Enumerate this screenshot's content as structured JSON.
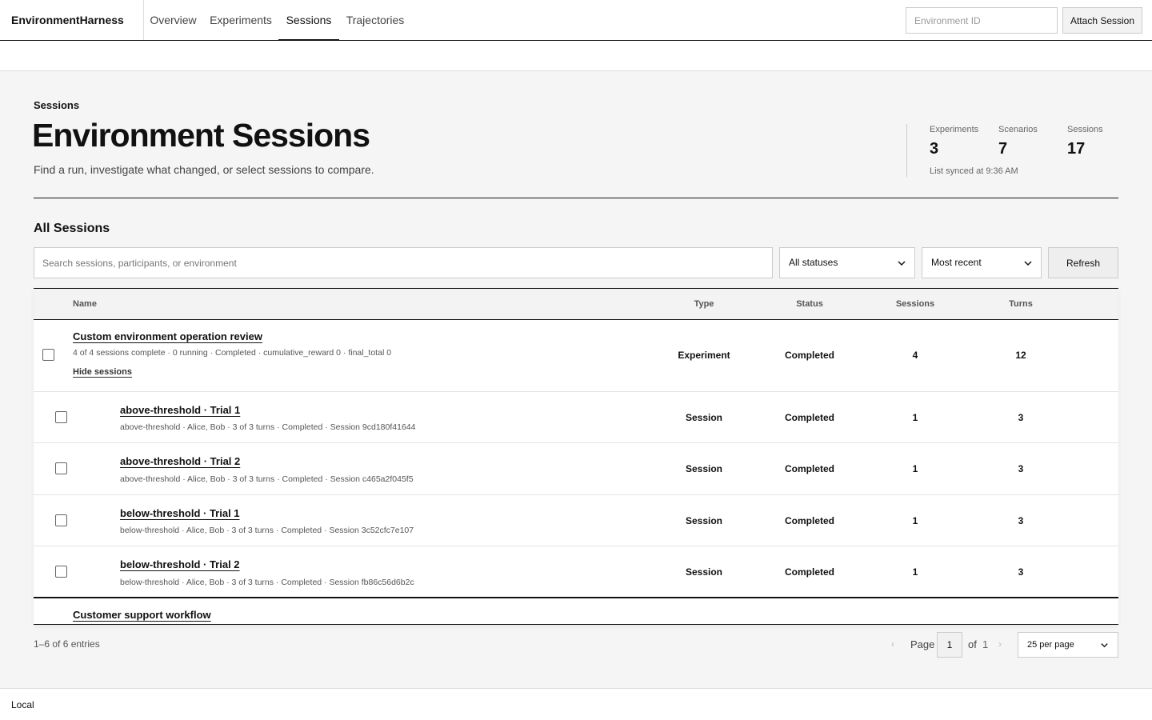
{
  "header": {
    "brand": "EnvironmentHarness",
    "tabs": [
      {
        "label": "Overview"
      },
      {
        "label": "Experiments"
      },
      {
        "label": "Sessions"
      },
      {
        "label": "Trajectories"
      }
    ],
    "active_tab": "Sessions",
    "environment_placeholder": "Environment ID",
    "attach_label": "Attach Session"
  },
  "page": {
    "eyebrow": "Sessions",
    "title": "Environment Sessions",
    "subtitle": "Find a run, investigate what changed, or select sessions to compare."
  },
  "stats": {
    "items": [
      {
        "label": "Experiments",
        "value": "3"
      },
      {
        "label": "Scenarios",
        "value": "7"
      },
      {
        "label": "Sessions",
        "value": "17"
      }
    ],
    "sync_text": "List synced at 9:36 AM"
  },
  "sessions": {
    "title": "All Sessions",
    "search_placeholder": "Search sessions, participants, or environment",
    "status_filter": "All statuses",
    "sort": "Most recent",
    "refresh_label": "Refresh",
    "columns": {
      "name": "Name",
      "type": "Type",
      "status": "Status",
      "sessions": "Sessions",
      "turns": "Turns"
    },
    "group": {
      "title": "Custom environment operation review",
      "meta": "4 of 4 sessions complete · 0 running · Completed · cumulative_reward 0 · final_total 0",
      "toggle": "Hide sessions",
      "type": "Experiment",
      "status": "Completed",
      "sessions": "4",
      "turns": "12"
    },
    "rows": [
      {
        "title": "above-threshold · Trial 1",
        "meta": "above-threshold · Alice, Bob · 3 of 3 turns · Completed · Session 9cd180f41644",
        "type": "Session",
        "status": "Completed",
        "sessions": "1",
        "turns": "3"
      },
      {
        "title": "above-threshold · Trial 2",
        "meta": "above-threshold · Alice, Bob · 3 of 3 turns · Completed · Session c465a2f045f5",
        "type": "Session",
        "status": "Completed",
        "sessions": "1",
        "turns": "3"
      },
      {
        "title": "below-threshold · Trial 1",
        "meta": "below-threshold · Alice, Bob · 3 of 3 turns · Completed · Session 3c52cfc7e107",
        "type": "Session",
        "status": "Completed",
        "sessions": "1",
        "turns": "3"
      },
      {
        "title": "below-threshold · Trial 2",
        "meta": "below-threshold · Alice, Bob · 3 of 3 turns · Completed · Session fb86c56d6b2c",
        "type": "Session",
        "status": "Completed",
        "sessions": "1",
        "turns": "3"
      }
    ],
    "next_group_title": "Customer support workflow"
  },
  "pagination": {
    "entries": "1–6 of 6 entries",
    "page_label": "Page",
    "page": "1",
    "of_label": "of",
    "total_pages": "1",
    "per_page": "25 per page"
  },
  "footer": {
    "text": "Local"
  }
}
